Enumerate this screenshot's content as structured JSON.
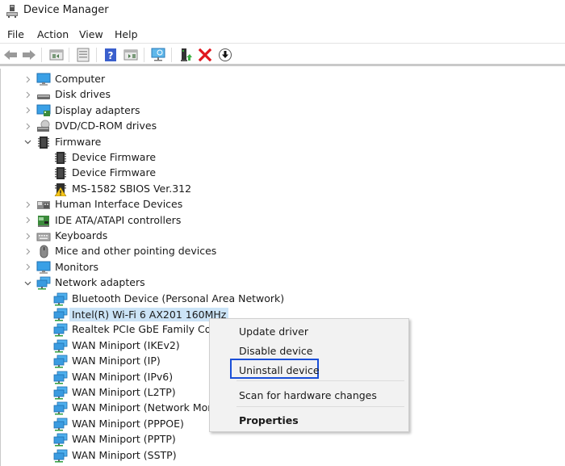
{
  "window": {
    "title": "Device Manager",
    "icon": "device-manager-icon"
  },
  "menu": [
    "File",
    "Action",
    "View",
    "Help"
  ],
  "toolbar": [
    {
      "name": "back-button",
      "icon": "arrow-left-icon"
    },
    {
      "name": "forward-button",
      "icon": "arrow-right-icon"
    },
    {
      "name": "show-hide-console-tree-button",
      "icon": "console-tree-icon"
    },
    {
      "name": "properties-button",
      "icon": "properties-sheet-icon"
    },
    {
      "name": "help-button",
      "icon": "help-icon"
    },
    {
      "name": "show-hide-action-pane-button",
      "icon": "action-pane-icon"
    },
    {
      "name": "scan-hardware-button",
      "icon": "monitor-scan-icon"
    },
    {
      "name": "update-driver-button",
      "icon": "update-driver-icon"
    },
    {
      "name": "uninstall-device-button",
      "icon": "red-x-icon"
    },
    {
      "name": "disable-device-button",
      "icon": "down-arrow-circle-icon"
    }
  ],
  "tree": [
    {
      "label": "Computer",
      "level": 0,
      "expanded": false,
      "icon": "computer-icon"
    },
    {
      "label": "Disk drives",
      "level": 0,
      "expanded": false,
      "icon": "disk-drive-icon"
    },
    {
      "label": "Display adapters",
      "level": 0,
      "expanded": false,
      "icon": "display-adapter-icon"
    },
    {
      "label": "DVD/CD-ROM drives",
      "level": 0,
      "expanded": false,
      "icon": "dvd-drive-icon"
    },
    {
      "label": "Firmware",
      "level": 0,
      "expanded": true,
      "icon": "firmware-chip-icon"
    },
    {
      "label": "Device Firmware",
      "level": 1,
      "icon": "firmware-chip-icon"
    },
    {
      "label": "Device Firmware",
      "level": 1,
      "icon": "firmware-chip-icon"
    },
    {
      "label": "MS-1582 SBIOS Ver.312",
      "level": 1,
      "icon": "firmware-warning-icon"
    },
    {
      "label": "Human Interface Devices",
      "level": 0,
      "expanded": false,
      "icon": "hid-icon"
    },
    {
      "label": "IDE ATA/ATAPI controllers",
      "level": 0,
      "expanded": false,
      "icon": "ide-controller-icon"
    },
    {
      "label": "Keyboards",
      "level": 0,
      "expanded": false,
      "icon": "keyboard-icon"
    },
    {
      "label": "Mice and other pointing devices",
      "level": 0,
      "expanded": false,
      "icon": "mouse-icon"
    },
    {
      "label": "Monitors",
      "level": 0,
      "expanded": false,
      "icon": "monitor-icon"
    },
    {
      "label": "Network adapters",
      "level": 0,
      "expanded": true,
      "icon": "network-adapter-icon"
    },
    {
      "label": "Bluetooth Device (Personal Area Network)",
      "level": 1,
      "icon": "network-adapter-icon"
    },
    {
      "label": "Intel(R) Wi-Fi 6 AX201 160MHz",
      "level": 1,
      "icon": "network-adapter-icon",
      "selected": true
    },
    {
      "label": "Realtek PCIe GbE Family Controller",
      "level": 1,
      "icon": "network-adapter-icon"
    },
    {
      "label": "WAN Miniport (IKEv2)",
      "level": 1,
      "icon": "network-adapter-icon"
    },
    {
      "label": "WAN Miniport (IP)",
      "level": 1,
      "icon": "network-adapter-icon"
    },
    {
      "label": "WAN Miniport (IPv6)",
      "level": 1,
      "icon": "network-adapter-icon"
    },
    {
      "label": "WAN Miniport (L2TP)",
      "level": 1,
      "icon": "network-adapter-icon"
    },
    {
      "label": "WAN Miniport (Network Monitor)",
      "level": 1,
      "icon": "network-adapter-icon"
    },
    {
      "label": "WAN Miniport (PPPOE)",
      "level": 1,
      "icon": "network-adapter-icon"
    },
    {
      "label": "WAN Miniport (PPTP)",
      "level": 1,
      "icon": "network-adapter-icon"
    },
    {
      "label": "WAN Miniport (SSTP)",
      "level": 1,
      "icon": "network-adapter-icon"
    }
  ],
  "context_menu": {
    "items": [
      {
        "label": "Update driver"
      },
      {
        "label": "Disable device"
      },
      {
        "label": "Uninstall device",
        "highlighted": true
      },
      {
        "label": "Scan for hardware changes"
      },
      {
        "label": "Properties",
        "bold": true
      }
    ],
    "highlight_color": "#1a4fd8"
  },
  "colors": {
    "selection": "#cce4f7",
    "menu_bg": "#f2f2f2"
  }
}
